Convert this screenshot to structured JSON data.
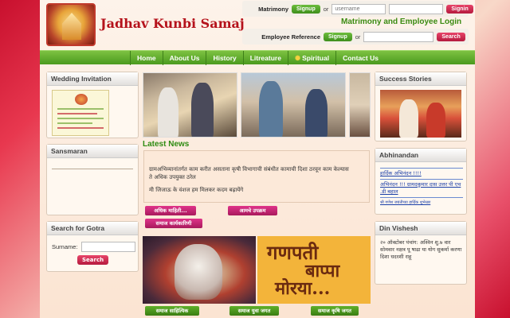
{
  "header": {
    "site_title": "Jadhav Kunbi Samaj",
    "matrimony_label": "Matrimony",
    "employee_label": "Employee Reference",
    "signup_label": "Signup",
    "or_label": "or",
    "username_placeholder": "username",
    "signin_label": "Signin",
    "search_label": "Search",
    "login_heading": "Matrimony and Employee Login"
  },
  "nav": {
    "items": [
      "Home",
      "About Us",
      "History",
      "Litreature",
      "Spiritual",
      "Contact Us"
    ]
  },
  "left": {
    "wedding_title": "Wedding Invitation",
    "sansmaran_title": "Sansmaran",
    "gotra_title": "Search for Gotra",
    "surname_label": "Surname:",
    "gotra_search": "Search"
  },
  "center": {
    "latest_news": "Latest News",
    "news_line1": "ग्रामअभिव्यानांतर्गत काम करीत असताना कृषी विभागाची संबंधीत कामाची दिशा ठरवून काम केल्यास",
    "news_line2": "ते अधिक उपयुक्त ठरेल",
    "news_line3": "मी जिजाऊ के वंशज हम मिलकर कदम बढ़ायेंगे",
    "more_info": "अधिक माहिती...",
    "our_activities": "आमचे उपक्रम",
    "samaj_executive": "समाज कार्यकारिणी",
    "bappa_line1": "गणपती",
    "bappa_line2": "बाप्पा",
    "bappa_line3": "मोरया...",
    "samaj_literature": "समाज साहित्यिक",
    "samaj_youth": "समाज युवा जगत",
    "samaj_agri": "समाज कृषि जगत"
  },
  "right": {
    "success_title": "Success Stories",
    "abhinandan_title": "Abhinandan",
    "abhi_items": [
      "हार्दिक अभिनंदन !!!!",
      "अभिनंदन !!! ग्रामदकुमार दास उत्तर पी एच .डी बहाल"
    ],
    "abhi_small": "श्री गणेश जयंतीच्या हार्दिक शुभेच्छा",
    "din_title": "Din Vishesh",
    "din_text": "२० ऑक्टोबर पंचांग: अश्विन शु.७ वार सोमवार नक्षत्र पू षाढा या योग सुकर्मा करणा दिशा धदरशी राहू"
  }
}
